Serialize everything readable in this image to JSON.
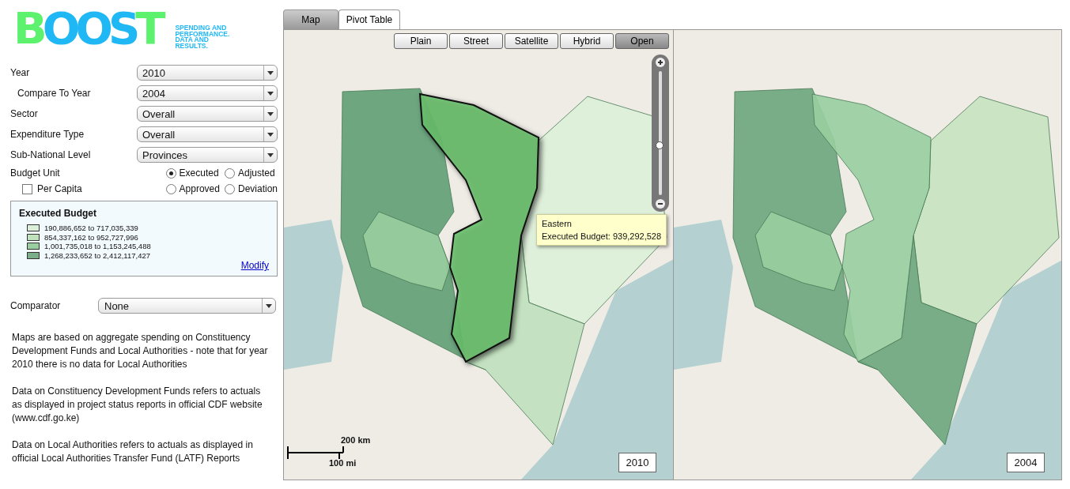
{
  "logo": {
    "letters": [
      {
        "char": "B",
        "color": "#5cf26e"
      },
      {
        "char": "O",
        "color": "#1fb8f5"
      },
      {
        "char": "O",
        "color": "#1fb8f5"
      },
      {
        "char": "S",
        "color": "#1fb8f5"
      },
      {
        "char": "T",
        "color": "#5cf26e"
      }
    ],
    "tagline": [
      "SPENDING AND",
      "PERFORMANCE.",
      "DATA AND",
      "RESULTS."
    ]
  },
  "filters": [
    {
      "label": "Year",
      "value": "2010",
      "indented": false
    },
    {
      "label": "Compare To Year",
      "value": "2004",
      "indented": true
    },
    {
      "label": "Sector",
      "value": "Overall",
      "indented": false
    },
    {
      "label": "Expenditure Type",
      "value": "Overall",
      "indented": false
    },
    {
      "label": "Sub-National Level",
      "value": "Provinces",
      "indented": false
    }
  ],
  "budget_unit": {
    "label": "Budget Unit",
    "options": [
      {
        "label": "Executed",
        "selected": true
      },
      {
        "label": "Adjusted",
        "selected": false
      },
      {
        "label": "Approved",
        "selected": false
      },
      {
        "label": "Deviation",
        "selected": false
      }
    ]
  },
  "per_capita": {
    "label": "Per Capita",
    "checked": false
  },
  "legend": {
    "title": "Executed Budget",
    "items": [
      {
        "label": "190,886,652 to 717,035,339",
        "color": "#dcefd8"
      },
      {
        "label": "854,337,162 to 952,727,996",
        "color": "#bfe1bc"
      },
      {
        "label": "1,001,735,018 to 1,153,245,488",
        "color": "#98cea0"
      },
      {
        "label": "1,268,233,652 to 2,412,117,427",
        "color": "#79b08a"
      }
    ],
    "link": "Modify"
  },
  "comparator": {
    "label": "Comparator",
    "value": "None"
  },
  "notes": [
    "Maps are based on aggregate spending on Constituency Development Funds and Local Authorities - note that for year 2010 there is no data for Local Authorities",
    "Data on Constituency Development Funds refers to actuals as displayed in project status reports in official CDF website (www.cdf.go.ke)",
    "Data on Local Authorities refers to actuals as displayed in official Local Authorities Transfer Fund (LATF) Reports"
  ],
  "tabs": [
    {
      "label": "Map",
      "selected": true
    },
    {
      "label": "Pivot Table",
      "selected": false
    }
  ],
  "map_types": [
    {
      "label": "Plain",
      "selected": false
    },
    {
      "label": "Street",
      "selected": false
    },
    {
      "label": "Satellite",
      "selected": false
    },
    {
      "label": "Hybrid",
      "selected": false
    },
    {
      "label": "Open",
      "selected": true
    }
  ],
  "zoom": {
    "level": 0.4
  },
  "maps": [
    {
      "year": "2010",
      "regions": [
        {
          "color": "#5e9e73",
          "highlighted": false
        },
        {
          "color": "#dcefd8",
          "highlighted": false
        },
        {
          "color": "#bfe1bc",
          "highlighted": false
        },
        {
          "color": "#98cea0",
          "highlighted": false
        },
        {
          "color": "#6cc26f",
          "highlighted": true
        }
      ],
      "tooltip": {
        "title": "Eastern",
        "text": "Executed Budget: 939,292,528"
      },
      "scale": {
        "km": "200 km",
        "mi": "100 mi"
      }
    },
    {
      "year": "2004",
      "regions": [
        {
          "color": "#6aa67c",
          "highlighted": false
        },
        {
          "color": "#c6e3c0",
          "highlighted": false
        },
        {
          "color": "#6aa67c",
          "highlighted": false
        },
        {
          "color": "#98cea0",
          "highlighted": false
        },
        {
          "color": "#98cea0",
          "highlighted": false
        }
      ]
    }
  ]
}
